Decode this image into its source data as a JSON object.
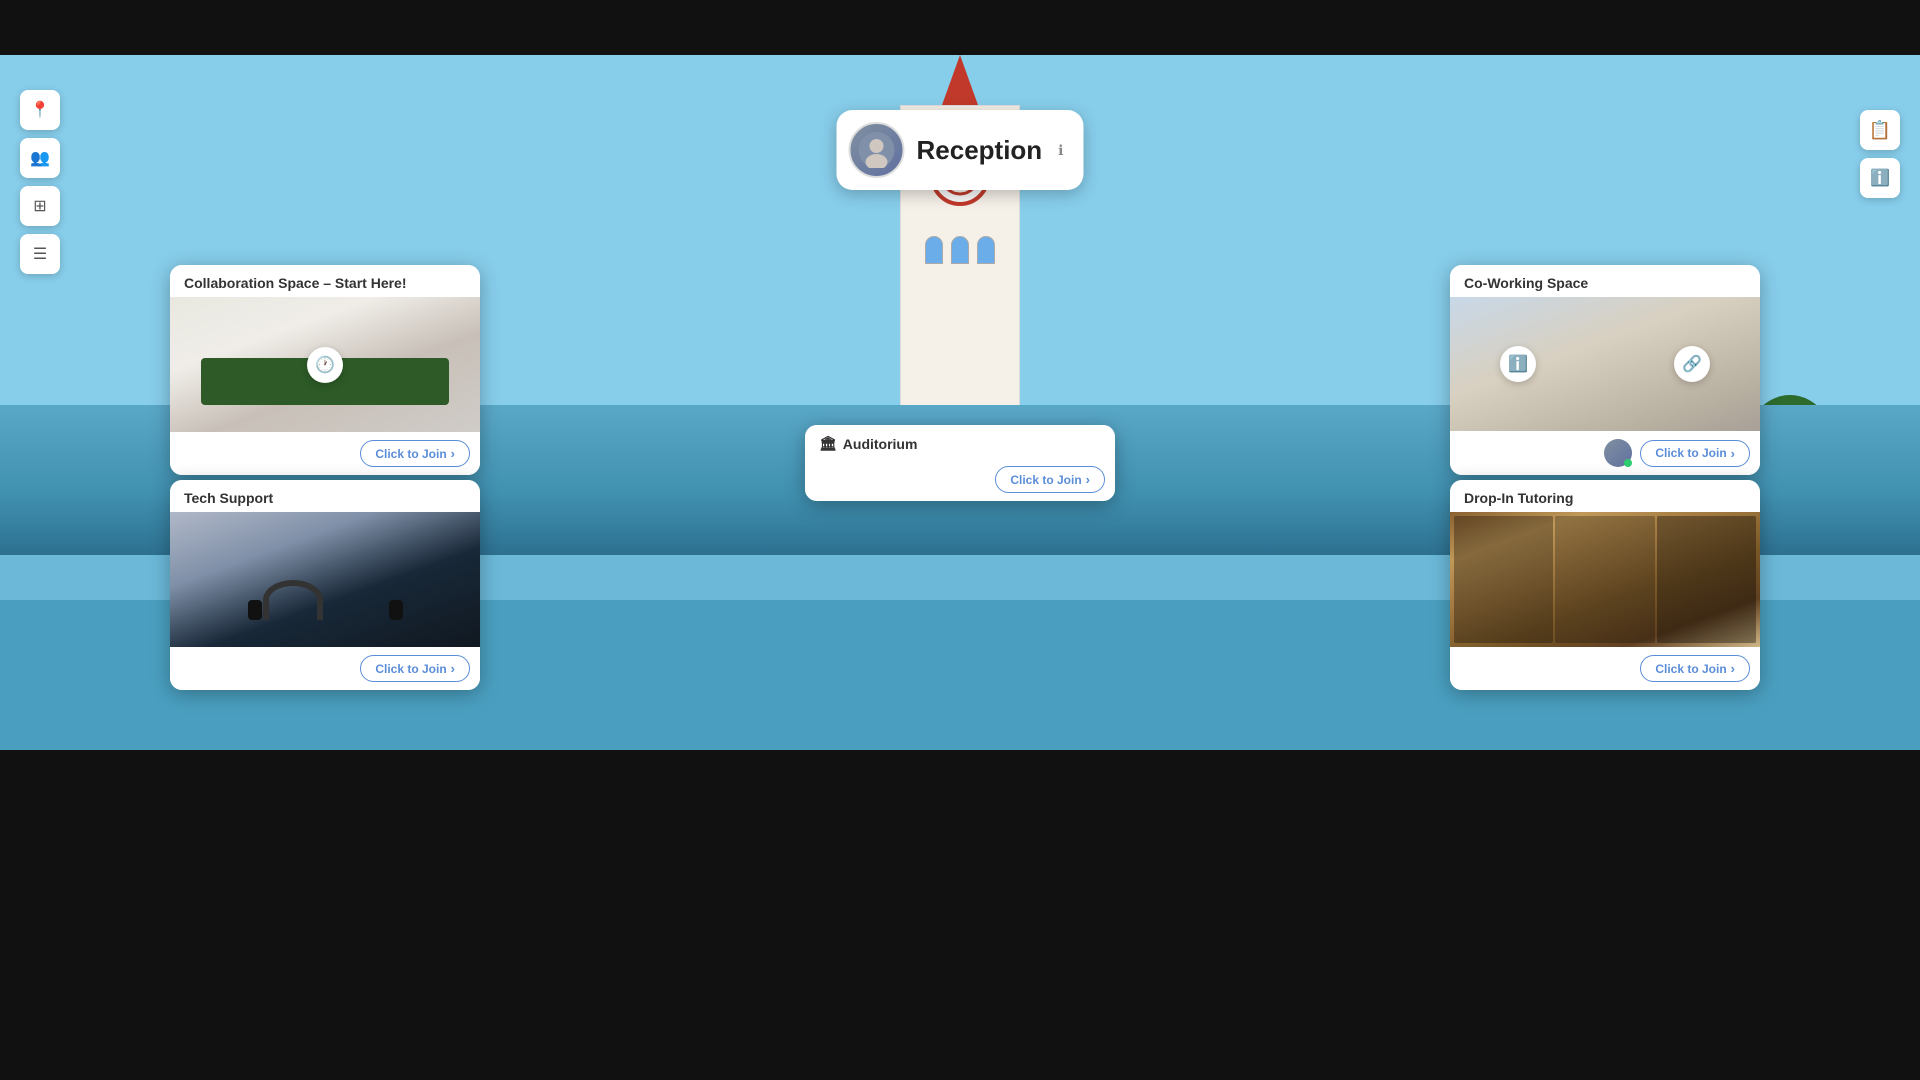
{
  "topBar": {
    "height": 55
  },
  "reception": {
    "title": "Reception",
    "info_icon": "ℹ"
  },
  "sidebar_left": {
    "buttons": [
      {
        "name": "location-icon",
        "icon": "📍"
      },
      {
        "name": "people-icon",
        "icon": "👥"
      },
      {
        "name": "grid-icon",
        "icon": "⊞"
      },
      {
        "name": "list-icon",
        "icon": "☰"
      }
    ]
  },
  "sidebar_right": {
    "buttons": [
      {
        "name": "presentation-icon",
        "icon": "📋"
      },
      {
        "name": "info-icon",
        "icon": "ℹ"
      }
    ]
  },
  "rooms": [
    {
      "id": "collaboration",
      "title": "Collaboration Space – Start Here!",
      "join_label": "Click to Join",
      "position": "left-top"
    },
    {
      "id": "coworking",
      "title": "Co-Working Space",
      "join_label": "Click to Join",
      "position": "right-top"
    },
    {
      "id": "auditorium",
      "title": "Auditorium",
      "join_label": "Click to Join",
      "position": "center"
    },
    {
      "id": "techsupport",
      "title": "Tech Support",
      "join_label": "Click to Join",
      "position": "left-bottom"
    },
    {
      "id": "droptutoring",
      "title": "Drop-In Tutoring",
      "join_label": "Click to Join",
      "position": "right-bottom"
    }
  ]
}
